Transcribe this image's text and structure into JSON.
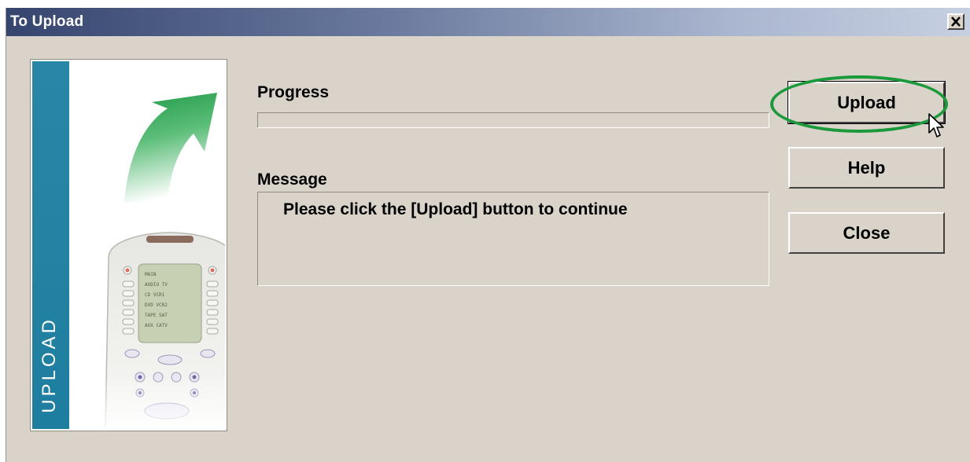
{
  "window": {
    "title": "To Upload",
    "close_glyph": "✕"
  },
  "side_panel": {
    "label": "UPLOAD",
    "stripe_color": "#2a86a6",
    "arrow_color": "#1f9a49",
    "remote_screen_lines": [
      "MAIN",
      "AUDIO  TV",
      "CD   VCR1",
      "DVD  VCR2",
      "TAPE  SAT",
      "AUX  CATV"
    ]
  },
  "main": {
    "progress_label": "Progress",
    "progress_value": 0,
    "message_label": "Message",
    "message_text": "Please click the [Upload] button to continue"
  },
  "buttons": {
    "upload": "Upload",
    "help": "Help",
    "close": "Close"
  },
  "annotation": {
    "ring_color": "#1b9a3c"
  }
}
